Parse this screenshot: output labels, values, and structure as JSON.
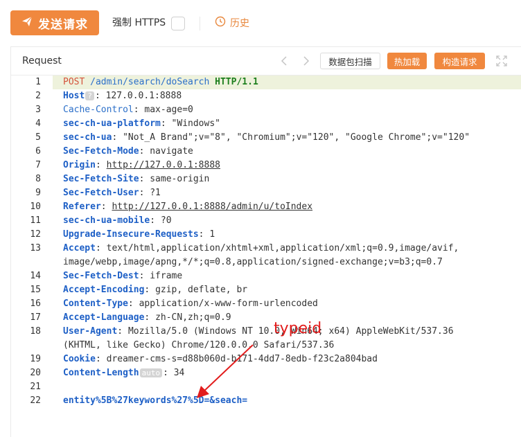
{
  "toolbar": {
    "send_label": "发送请求",
    "force_https_label": "强制 HTTPS",
    "force_https_checked": false,
    "history_label": "历史"
  },
  "panel": {
    "title": "Request",
    "buttons": {
      "scan": "数据包扫描",
      "hot_load": "热加载",
      "build": "构造请求"
    }
  },
  "editor": {
    "line_numbers": [
      "1",
      "2",
      "3",
      "4",
      "5",
      "6",
      "7",
      "8",
      "9",
      "10",
      "11",
      "12",
      "13",
      "14",
      "15",
      "16",
      "17",
      "18",
      "19",
      "20",
      "21",
      "22"
    ],
    "request_line": {
      "method": "POST",
      "path": "/admin/search/doSearch",
      "protocol": "HTTP/1.1"
    },
    "headers": [
      {
        "name": "Host",
        "badge": "?",
        "value": "127.0.0.1:8888"
      },
      {
        "name": "Cache-Control",
        "value": "max-age=0"
      },
      {
        "name": "sec-ch-ua-platform",
        "value": "\"Windows\""
      },
      {
        "name": "sec-ch-ua",
        "value": "\"Not_A Brand\";v=\"8\", \"Chromium\";v=\"120\", \"Google Chrome\";v=\"120\""
      },
      {
        "name": "Sec-Fetch-Mode",
        "value": "navigate"
      },
      {
        "name": "Origin",
        "value": "http://127.0.0.1:8888"
      },
      {
        "name": "Sec-Fetch-Site",
        "value": "same-origin"
      },
      {
        "name": "Sec-Fetch-User",
        "value": "?1"
      },
      {
        "name": "Referer",
        "value": "http://127.0.0.1:8888/admin/u/toIndex"
      },
      {
        "name": "sec-ch-ua-mobile",
        "value": "?0"
      },
      {
        "name": "Upgrade-Insecure-Requests",
        "value": "1"
      },
      {
        "name": "Accept",
        "value": "text/html,application/xhtml+xml,application/xml;q=0.9,image/avif,",
        "value2": "image/webp,image/apng,*/*;q=0.8,application/signed-exchange;v=b3;q=0.7"
      },
      {
        "name": "Sec-Fetch-Dest",
        "value": "iframe"
      },
      {
        "name": "Accept-Encoding",
        "value": "gzip, deflate, br"
      },
      {
        "name": "Content-Type",
        "value": "application/x-www-form-urlencoded"
      },
      {
        "name": "Accept-Language",
        "value": "zh-CN,zh;q=0.9"
      },
      {
        "name": "User-Agent",
        "value": "Mozilla/5.0 (Windows NT 10.0; Win64; x64) AppleWebKit/537.36",
        "value2": "(KHTML, like Gecko) Chrome/120.0.0.0 Safari/537.36"
      },
      {
        "name": "Cookie",
        "value": "dreamer-cms-s=d88b060d-b171-4dd7-8edb-f23c2a804bad"
      },
      {
        "name": "Content-Length",
        "badge": "auto",
        "value": "34"
      }
    ],
    "body": "entity%5B%27keywords%27%5D=&seach="
  },
  "annotation": {
    "text": "typeid",
    "color": "#e21c1c"
  },
  "colors": {
    "accent": "#f0883e",
    "header_key": "#1d5fc6",
    "method": "#d4533b",
    "protocol": "#1d7f1d",
    "line_highlight": "#eef2dc"
  }
}
